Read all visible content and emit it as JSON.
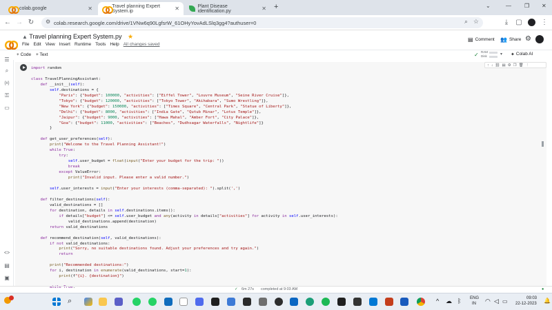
{
  "browser": {
    "tabs": [
      {
        "title": "colab.google",
        "active": false
      },
      {
        "title": "Travel planning Expert System.ip",
        "active": true
      },
      {
        "title": "Plant Disease identification.py",
        "active": false
      }
    ],
    "new_tab": "+",
    "window_controls": [
      "⌄",
      "—",
      "❐",
      "✕"
    ],
    "url": "colab.research.google.com/drive/1VNw6q90LgfsrW_61OHyYovAdLSlq3gg4?authuser=0"
  },
  "colab": {
    "doc_title": "Travel planning Expert System.py",
    "menu": [
      "File",
      "Edit",
      "View",
      "Insert",
      "Runtime",
      "Tools",
      "Help"
    ],
    "save_status": "All changes saved",
    "comment_label": "Comment",
    "share_label": "Share",
    "add_code": "+ Code",
    "add_text": "+ Text",
    "ram_label": "RAM",
    "disk_label": "Disk",
    "colab_ai": "Colab AI"
  },
  "code_lines": [
    "import random",
    "",
    "class TravelPlanningAssistant:",
    "    def __init__(self):",
    "        self.destinations = {",
    "            \"Paris\": {\"budget\": 100000, \"activities\": [\"Eiffel Tower\", \"Louvre Museum\", \"Seine River Cruise\"]},",
    "            \"Tokyo\": {\"budget\": 120000, \"activities\": [\"Tokyo Tower\", \"Akihabara\", \"Sumo Wrestling\"]},",
    "            \"New York\": {\"budget\": 150000, \"activities\": [\"Times Square\", \"Central Park\", \"Statue of Liberty\"]},",
    "            \"Delhi\": {\"budget\": 8000, \"activities\": [\"India Gate\", \"Qutub Minar\", \"Lotus Temple\"]},",
    "            \"Jaipur\": {\"budget\": 9000, \"activities\": [\"Hawa Mahal\", \"Amber Fort\", \"City Palace\"]},",
    "            \"Goa\": {\"budget\": 11000, \"activities\": [\"Beaches\", \"Dudhsagar Waterfalls\", \"Nightlife\"]}",
    "        }",
    "",
    "    def get_user_preferences(self):",
    "        print(\"Welcome to the Travel Planning Assistant!\")",
    "        while True:",
    "            try:",
    "                self.user_budget = float(input(\"Enter your budget for the trip: \"))",
    "                break",
    "            except ValueError:",
    "                print(\"Invalid input. Please enter a valid number.\")",
    "",
    "        self.user_interests = input(\"Enter your interests (comma-separated): \").split(',')",
    "",
    "    def filter_destinations(self):",
    "        valid_destinations = []",
    "        for destination, details in self.destinations.items():",
    "            if details[\"budget\"] <= self.user_budget and any(activity in details[\"activities\"] for activity in self.user_interests):",
    "                valid_destinations.append(destination)",
    "        return valid_destinations",
    "",
    "    def recommend_destination(self, valid_destinations):",
    "        if not valid_destinations:",
    "            print(\"Sorry, no suitable destinations found. Adjust your preferences and try again.\")",
    "            return",
    "",
    "        print(\"Recommended destinations:\")",
    "        for i, destination in enumerate(valid_destinations, start=1):",
    "            print(f\"{i}. {destination}\")",
    "",
    "        while True:"
  ],
  "status": {
    "check": "✓",
    "elapsed": "6m 27s",
    "completed": "completed at 9:03 AM"
  },
  "taskbar": {
    "lang_line1": "ENG",
    "lang_line2": "IN",
    "time": "09:03",
    "date": "22-12-2023"
  }
}
